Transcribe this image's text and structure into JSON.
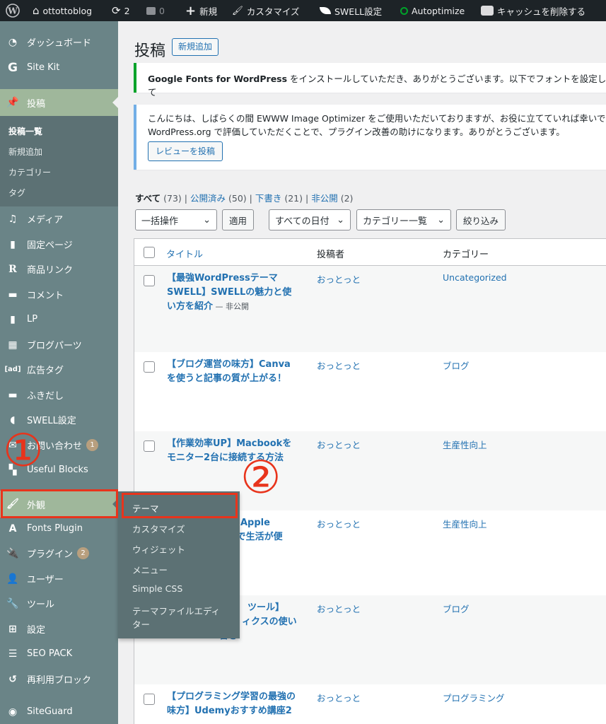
{
  "adminbar": {
    "site_name": "ottottoblog",
    "updates_count": "2",
    "comments_count": "0",
    "new_label": "新規",
    "customize_label": "カスタマイズ",
    "swell_label": "SWELL設定",
    "autoptimize_label": "Autoptimize",
    "cache_label": "キャッシュを削除する"
  },
  "sidebar": {
    "items": [
      {
        "label": "ダッシュボード",
        "icon": "dashboard-icon"
      },
      {
        "label": "Site Kit",
        "icon": "sitekit-icon"
      },
      {
        "label": "投稿",
        "icon": "pin-icon"
      },
      {
        "label": "メディア",
        "icon": "media-icon"
      },
      {
        "label": "固定ページ",
        "icon": "page-icon"
      },
      {
        "label": "商品リンク",
        "icon": "rinker-icon"
      },
      {
        "label": "コメント",
        "icon": "comment-icon"
      },
      {
        "label": "LP",
        "icon": "document-icon"
      },
      {
        "label": "ブログパーツ",
        "icon": "blogparts-icon"
      },
      {
        "label": "広告タグ",
        "icon": "ad-icon"
      },
      {
        "label": "ふきだし",
        "icon": "balloon-icon"
      },
      {
        "label": "SWELL設定",
        "icon": "swell-icon"
      },
      {
        "label": "お問い合わせ",
        "icon": "mail-icon",
        "badge": "1"
      },
      {
        "label": "Useful Blocks",
        "icon": "blocks-icon"
      },
      {
        "label": "外観",
        "icon": "brush-icon"
      },
      {
        "label": "Fonts Plugin",
        "icon": "font-icon"
      },
      {
        "label": "プラグイン",
        "icon": "plugin-icon",
        "badge": "2"
      },
      {
        "label": "ユーザー",
        "icon": "user-icon"
      },
      {
        "label": "ツール",
        "icon": "wrench-icon"
      },
      {
        "label": "設定",
        "icon": "settings-icon"
      },
      {
        "label": "SEO PACK",
        "icon": "list-icon"
      },
      {
        "label": "再利用ブロック",
        "icon": "reuse-icon"
      },
      {
        "label": "SiteGuard",
        "icon": "siteguard-icon"
      }
    ],
    "posts_submenu": [
      "投稿一覧",
      "新規追加",
      "カテゴリー",
      "タグ"
    ]
  },
  "flyout": {
    "items": [
      "テーマ",
      "カスタマイズ",
      "ウィジェット",
      "メニュー",
      "Simple CSS",
      "テーマファイルエディ",
      "ター"
    ]
  },
  "annotations": {
    "one": "①",
    "two": "②"
  },
  "main": {
    "title": "投稿",
    "add_new": "新規追加",
    "notice1_bold": "Google Fonts for WordPress",
    "notice1_text": " をインストールしていただき、ありがとうございます。以下でフォントを設定して",
    "notice2_line1": "こんにちは、しばらくの間 EWWW Image Optimizer をご使用いただいておりますが、お役に立てていれば幸いで",
    "notice2_line2": "WordPress.org で評価していただくことで、プラグイン改善の助けになります。ありがとうございます。",
    "notice2_button": "レビューを投稿",
    "views": {
      "all": "すべて",
      "all_count": "(73)",
      "published": "公開済み",
      "published_count": "(50)",
      "draft": "下書き",
      "draft_count": "(21)",
      "private": "非公開",
      "private_count": "(2)",
      "sep": "|"
    },
    "bulk_action": "一括操作",
    "apply": "適用",
    "all_dates": "すべての日付",
    "category_all": "カテゴリー一覧",
    "filter": "絞り込み",
    "columns": {
      "title": "タイトル",
      "author": "投稿者",
      "category": "カテゴリー"
    },
    "rows": [
      {
        "title_lines": [
          "【最強WordPressテーマ",
          "SWELL】SWELLの魅力と使",
          "い方を紹介"
        ],
        "state": " — 非公開",
        "author": "おっとっと",
        "category": "Uncategorized"
      },
      {
        "title_lines": [
          "【ブログ運営の味方】Canva",
          "を使うと記事の質が上がる！"
        ],
        "author": "おっとっと",
        "category": "ブログ"
      },
      {
        "title_lines": [
          "【作業効率UP】Macbookを",
          "モニター2台に接続する方法"
        ],
        "author": "おっとっと",
        "category": "生産性向上"
      },
      {
        "title_lines": [
          "Apple",
          "とで生活が便",
          "！"
        ],
        "author": "おっとっと",
        "category": "生産性向上"
      },
      {
        "title_lines": [
          "ツール】",
          "ィクスの使い",
          "書き"
        ],
        "author": "おっとっと",
        "category": "ブログ"
      },
      {
        "title_lines": [
          "【プログラミング学習の最強の",
          "味方】Udemyおすすめ講座2"
        ],
        "author": "おっとっと",
        "category": "プログラミング"
      }
    ]
  }
}
